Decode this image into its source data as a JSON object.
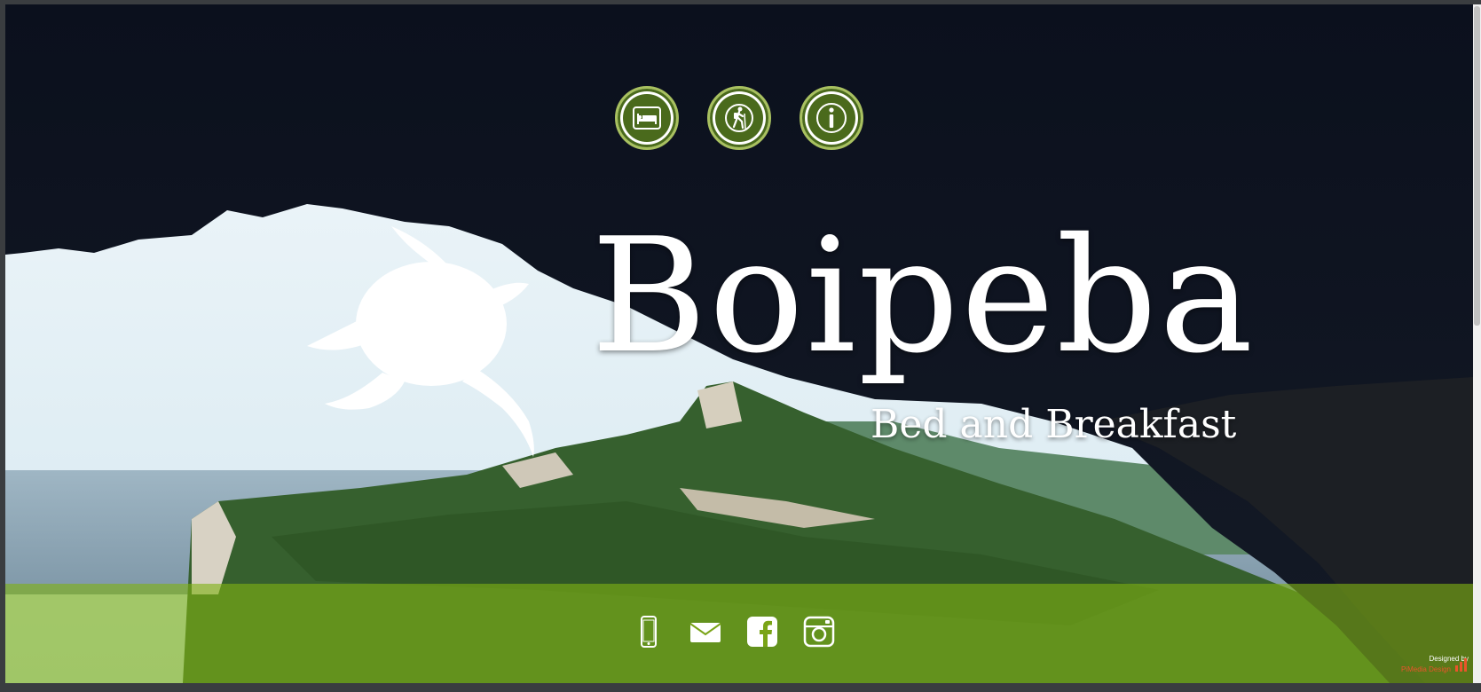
{
  "nav": {
    "items": [
      {
        "icon": "bed-icon",
        "label": ""
      },
      {
        "icon": "hiker-icon",
        "label": ""
      },
      {
        "icon": "info-icon",
        "label": ""
      }
    ]
  },
  "brand": {
    "title": "Boipeba",
    "subtitle": "Bed and Breakfast"
  },
  "social": {
    "items": [
      {
        "icon": "mobile-phone-icon"
      },
      {
        "icon": "envelope-icon"
      },
      {
        "icon": "facebook-icon"
      },
      {
        "icon": "instagram-icon"
      }
    ]
  },
  "credit": {
    "label": "Designed by",
    "name": "PiMedia Design"
  },
  "colors": {
    "nav_button": "#4a6a1c",
    "footer_overlay": "#80b214",
    "credit_accent": "#e8552a"
  }
}
